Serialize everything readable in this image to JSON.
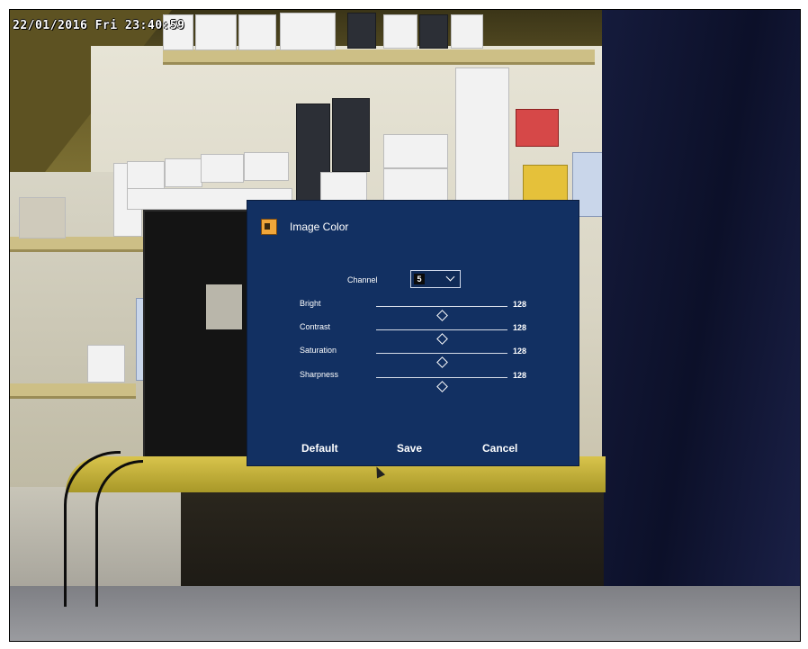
{
  "osd": {
    "timestamp": "22/01/2016 Fri 23:40:59"
  },
  "dialog": {
    "title": "Image Color",
    "icon": "image-color-icon",
    "channel": {
      "label": "Channel",
      "selected": "5"
    },
    "sliders": [
      {
        "label": "Bright",
        "value": "128",
        "fraction": 0.5
      },
      {
        "label": "Contrast",
        "value": "128",
        "fraction": 0.5
      },
      {
        "label": "Saturation",
        "value": "128",
        "fraction": 0.5
      },
      {
        "label": "Sharpness",
        "value": "128",
        "fraction": 0.5
      }
    ],
    "buttons": {
      "default": "Default",
      "save": "Save",
      "cancel": "Cancel"
    },
    "colors": {
      "panel": "#123062",
      "text": "#ffffff",
      "icon_accent": "#f0a63a"
    }
  }
}
